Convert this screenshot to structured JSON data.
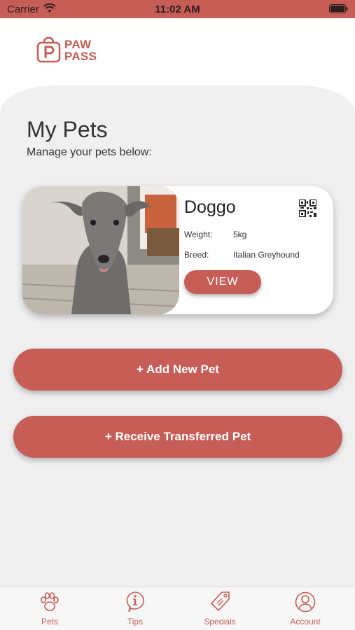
{
  "status_bar": {
    "carrier": "Carrier",
    "time": "11:02 AM"
  },
  "logo": {
    "line1": "PAW",
    "line2": "PASS",
    "letter": "P"
  },
  "main": {
    "title": "My Pets",
    "subtitle": "Manage your pets below:"
  },
  "pet": {
    "name": "Doggo",
    "weight_label": "Weight:",
    "weight_value": "5kg",
    "breed_label": "Breed:",
    "breed_value": "Italian Greyhound",
    "view_label": "VIEW"
  },
  "actions": {
    "add_pet": "+ Add New Pet",
    "receive_pet": "+ Receive Transferred Pet"
  },
  "tabs": [
    {
      "label": "Pets",
      "icon": "paw-icon"
    },
    {
      "label": "Tips",
      "icon": "info-icon"
    },
    {
      "label": "Specials",
      "icon": "tag-icon"
    },
    {
      "label": "Account",
      "icon": "account-icon"
    }
  ],
  "colors": {
    "accent": "#c75d57",
    "panel": "#f0f0f0"
  }
}
